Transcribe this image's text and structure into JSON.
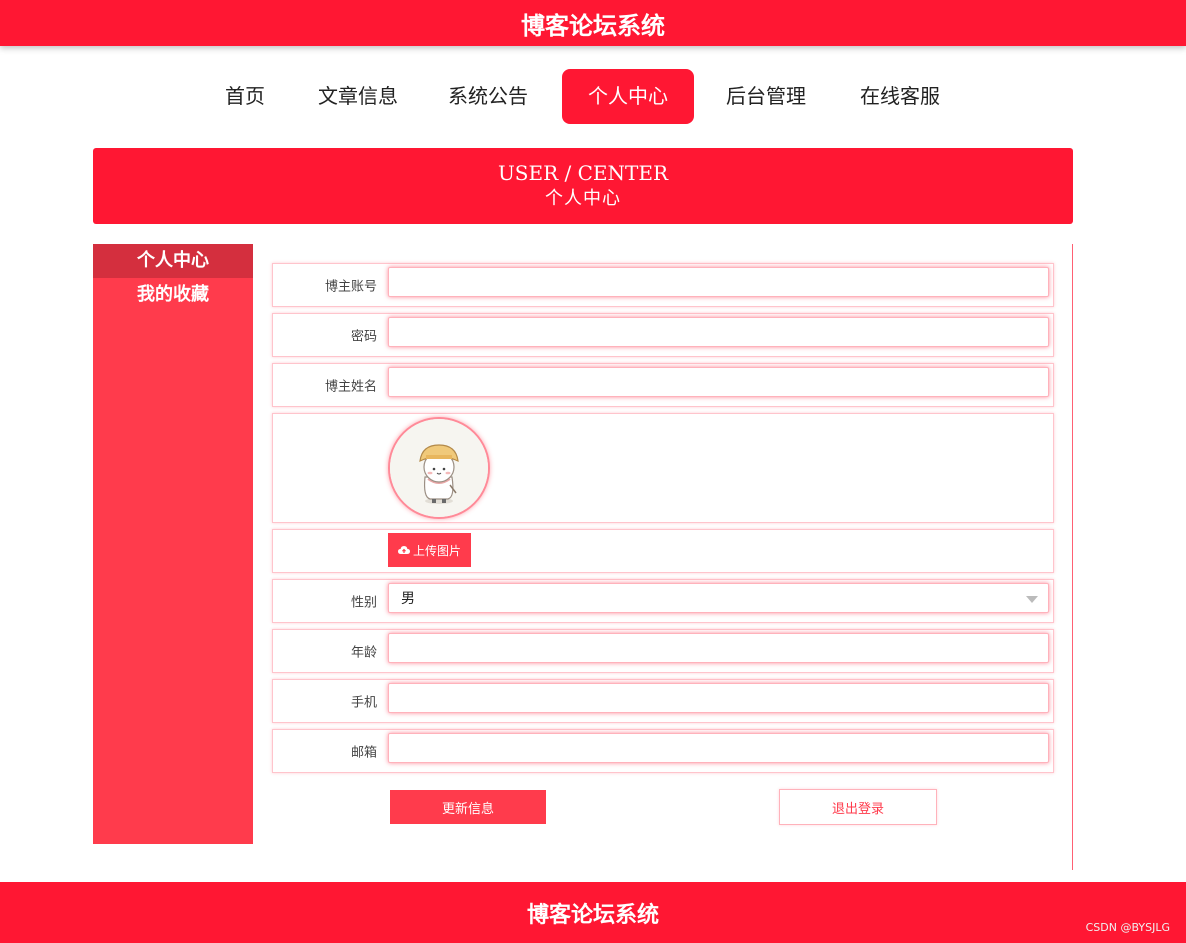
{
  "header": {
    "title": "博客论坛系统"
  },
  "nav": {
    "items": [
      {
        "label": "首页"
      },
      {
        "label": "文章信息"
      },
      {
        "label": "系统公告"
      },
      {
        "label": "个人中心"
      },
      {
        "label": "后台管理"
      },
      {
        "label": "在线客服"
      }
    ],
    "active_index": 3
  },
  "banner": {
    "en": "USER / CENTER",
    "cn": "个人中心"
  },
  "sidebar": {
    "items": [
      {
        "label": "个人中心"
      },
      {
        "label": "我的收藏"
      }
    ],
    "active_index": 0
  },
  "form": {
    "account_label": "博主账号",
    "account_value": "",
    "password_label": "密码",
    "password_value": "",
    "name_label": "博主姓名",
    "name_value": "",
    "upload_label": "上传图片",
    "gender_label": "性别",
    "gender_value": "男",
    "age_label": "年龄",
    "age_value": "",
    "phone_label": "手机",
    "phone_value": "",
    "email_label": "邮箱",
    "email_value": ""
  },
  "actions": {
    "update_label": "更新信息",
    "logout_label": "退出登录"
  },
  "footer": {
    "title": "博客论坛系统"
  },
  "watermark": "CSDN @BYSJLG",
  "colors": {
    "primary": "#ff1733",
    "accent": "#ff3b4c",
    "sidebar_active": "#d42f3e"
  }
}
